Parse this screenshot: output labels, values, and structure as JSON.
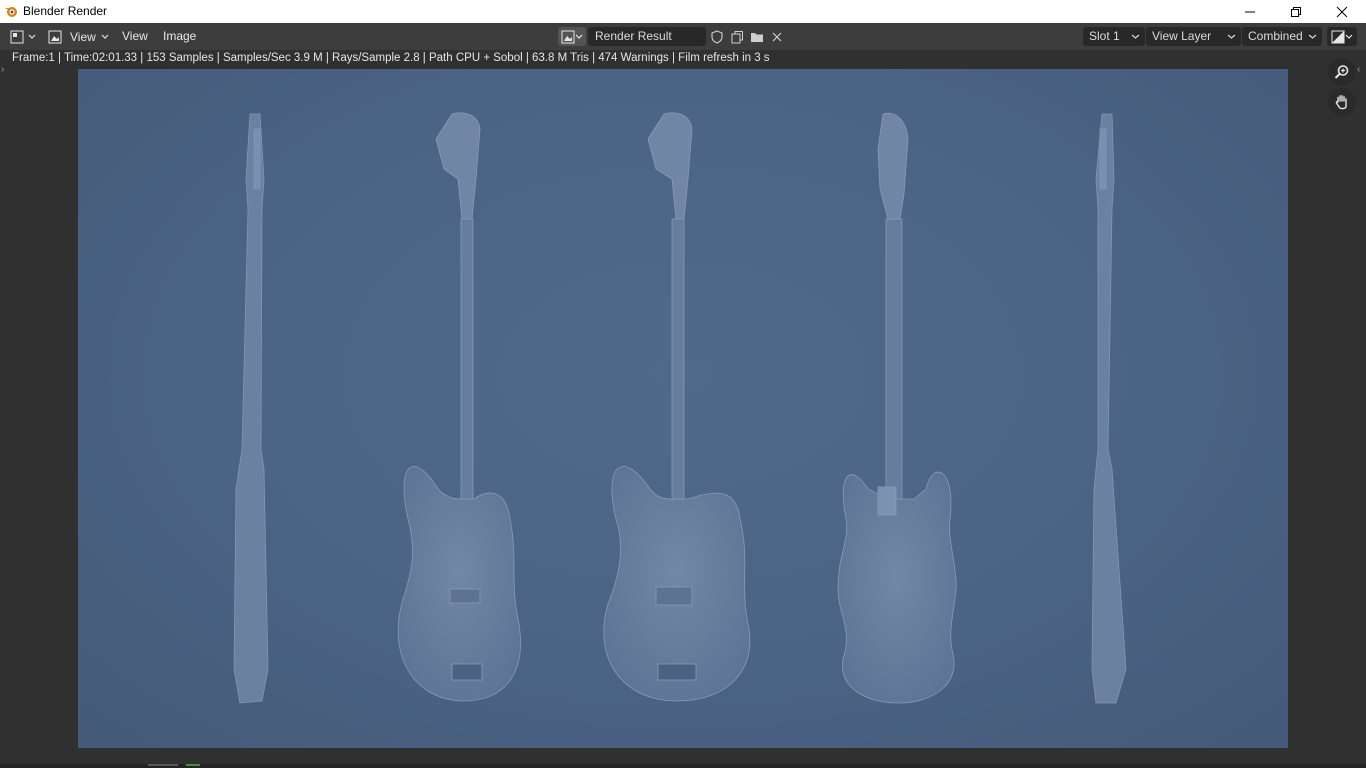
{
  "window": {
    "title": "Blender Render",
    "minimize_label": "—",
    "restore_label": "❐",
    "close_label": "✕"
  },
  "header": {
    "menus": [
      "View",
      "View",
      "Image"
    ],
    "image_name": "Render Result",
    "slot": "Slot 1",
    "view_layer": "View Layer",
    "pass": "Combined"
  },
  "status_text": "Frame:1 | Time:02:01.33 | 153 Samples | Samples/Sec 3.9 M | Rays/Sample 2.8 | Path CPU + Sobol | 63.8 M Tris | 474 Warnings | Film refresh in 3 s",
  "icons": {
    "app": "blender-logo-icon",
    "editor_type": "image-editor-icon",
    "mode": "view-mode-icon",
    "browse_image": "browse-image-icon",
    "fake_user": "shield-icon",
    "new_image": "new-image-icon",
    "open_image": "folder-icon",
    "unlink": "close-icon",
    "display_channels": "display-channels-icon",
    "zoom": "zoom-icon",
    "pan": "hand-icon"
  },
  "colors": {
    "header_bg": "#3d3d3d",
    "background": "#303030",
    "render_bg": "#4b6385",
    "guitar": "#6c83a3"
  }
}
